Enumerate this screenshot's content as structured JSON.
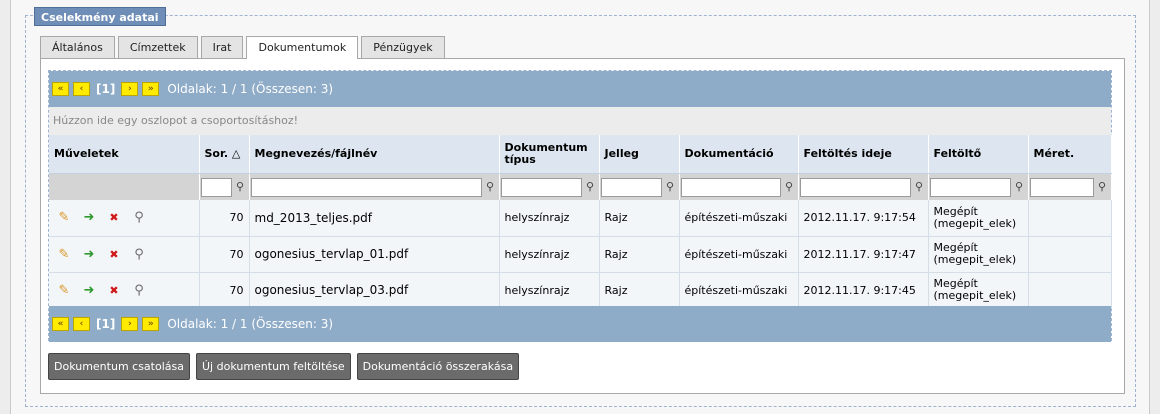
{
  "section_title": "Cselekmény adatai",
  "tabs": [
    {
      "label": "Általános"
    },
    {
      "label": "Címzettek"
    },
    {
      "label": "Irat"
    },
    {
      "label": "Dokumentumok"
    },
    {
      "label": "Pénzügyek"
    }
  ],
  "active_tab": "Dokumentumok",
  "pager": {
    "first": "«",
    "prev": "‹",
    "next": "›",
    "last": "»",
    "current": "[1]",
    "info": "Oldalak: 1 / 1 (Összesen: 3)"
  },
  "group_hint": "Húzzon ide egy oszlopot a csoportosításhoz!",
  "columns": [
    "Műveletek",
    "Sor. △",
    "Megnevezés/fájlnév",
    "Dokumentum típus",
    "Jelleg",
    "Dokumentáció",
    "Feltöltés ideje",
    "Feltöltő",
    "Méret."
  ],
  "rows": [
    {
      "sor": "70",
      "name": "md_2013_teljes.pdf",
      "tipus": "helyszínrajz",
      "jelleg": "Rajz",
      "dok": "építészeti-műszaki",
      "ido": "2012.11.17. 9:17:54",
      "feltolto": "Megépít (megepit_elek)",
      "meret": ""
    },
    {
      "sor": "70",
      "name": "ogonesius_tervlap_01.pdf",
      "tipus": "helyszínrajz",
      "jelleg": "Rajz",
      "dok": "építészeti-műszaki",
      "ido": "2012.11.17. 9:17:47",
      "feltolto": "Megépít (megepit_elek)",
      "meret": ""
    },
    {
      "sor": "70",
      "name": "ogonesius_tervlap_03.pdf",
      "tipus": "helyszínrajz",
      "jelleg": "Rajz",
      "dok": "építészeti-műszaki",
      "ido": "2012.11.17. 9:17:45",
      "feltolto": "Megépít (megepit_elek)",
      "meret": ""
    }
  ],
  "buttons": {
    "attach": "Dokumentum csatolása",
    "upload": "Új dokumentum feltöltése",
    "assemble": "Dokumentáció összerakása"
  },
  "icons": {
    "edit": "pencil-icon",
    "move": "arrow-icon",
    "delete": "delete-icon",
    "view": "magnifier-icon",
    "filter": "filter-icon"
  },
  "colors": {
    "pager_bg": "#8eabc8",
    "pager_button": "#ffea00",
    "header_bg": "#dde6f0",
    "legend_bg": "#6f8eb7"
  }
}
